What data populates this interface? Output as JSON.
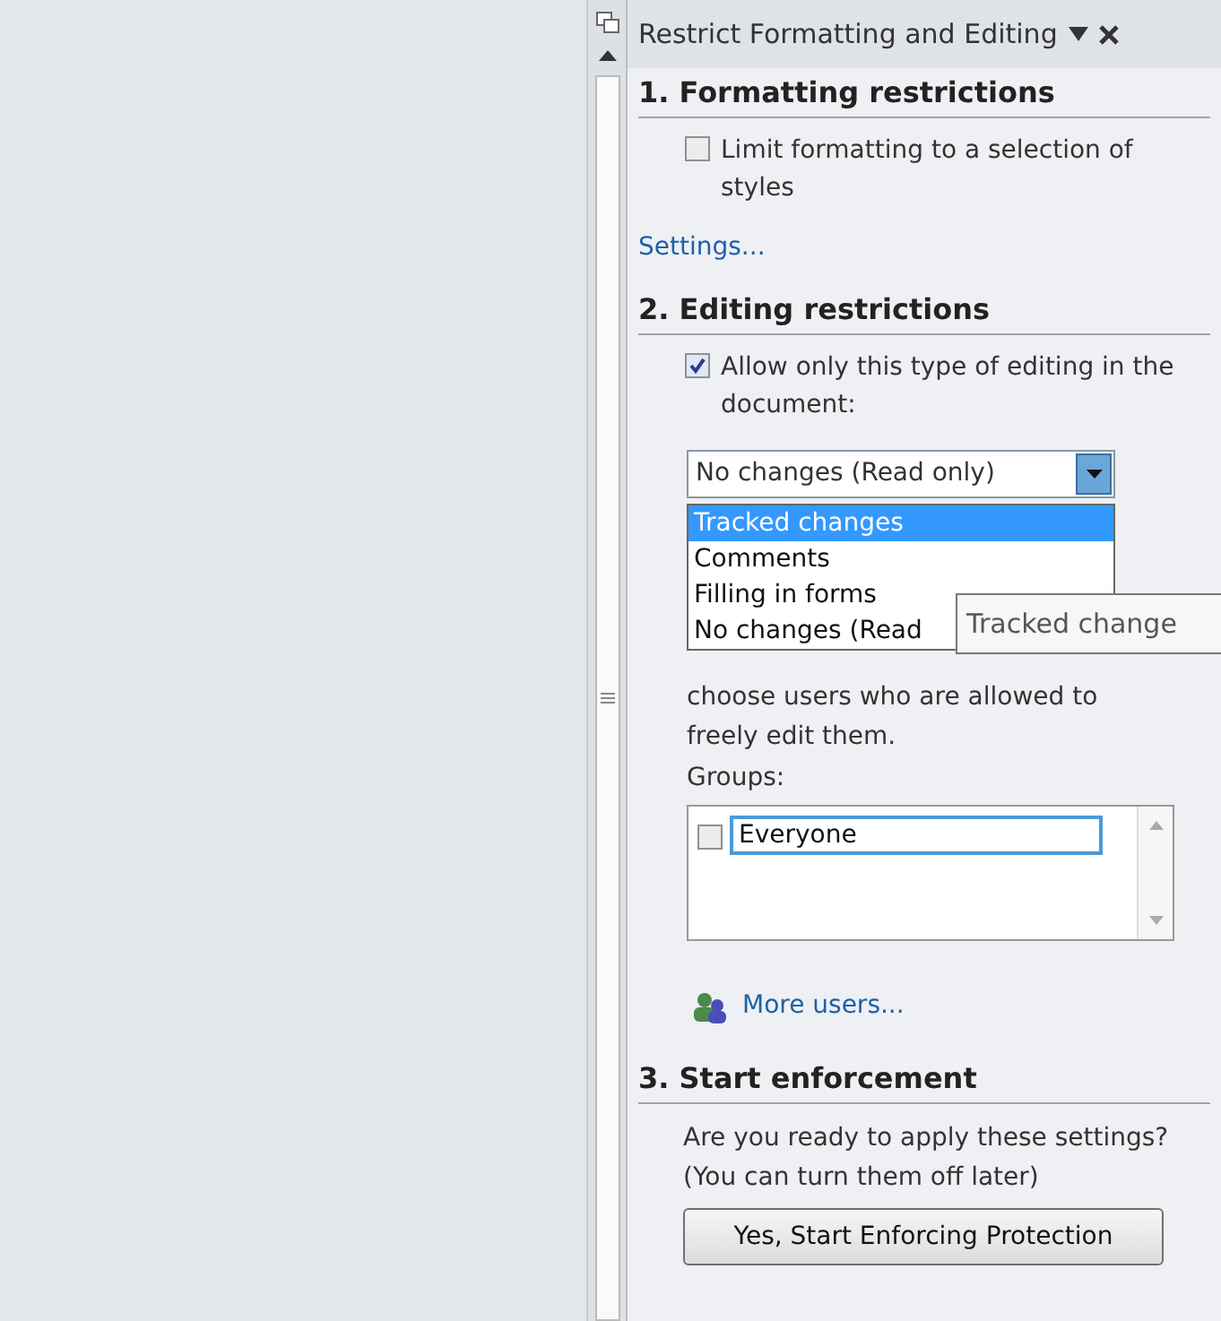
{
  "pane": {
    "title": "Restrict Formatting and Editing"
  },
  "formatting": {
    "heading": "1. Formatting restrictions",
    "checkbox": {
      "label": "Limit formatting to a selection of styles",
      "checked": false
    },
    "settings_link": "Settings..."
  },
  "editing": {
    "heading": "2. Editing restrictions",
    "checkbox": {
      "label": "Allow only this type of editing in the document:",
      "checked": true
    },
    "dropdown": {
      "value": "No changes (Read only)",
      "expanded": true,
      "options": [
        {
          "label": "Tracked changes",
          "selected": true
        },
        {
          "label": "Comments",
          "selected": false
        },
        {
          "label": "Filling in forms",
          "selected": false
        },
        {
          "label": "No changes (Read",
          "selected": false
        }
      ]
    },
    "tooltip": "Tracked change",
    "exceptions_text": "choose users who are allowed to freely edit them.",
    "groups_label": "Groups:",
    "groups": [
      {
        "name": "Everyone",
        "checked": false
      }
    ],
    "more_users_link": "More users..."
  },
  "enforcement": {
    "heading": "3. Start enforcement",
    "text": "Are you ready to apply these settings? (You can turn them off later)",
    "button": "Yes, Start Enforcing Protection"
  }
}
